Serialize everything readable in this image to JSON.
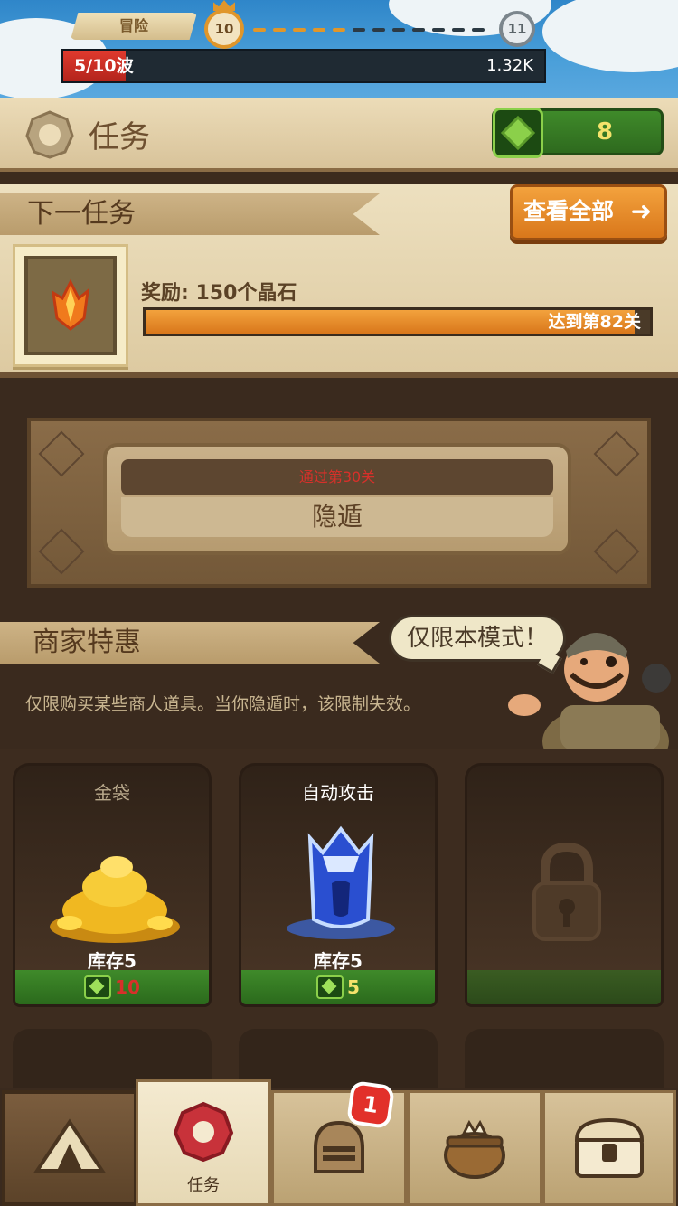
{
  "top_bar": {
    "mode_label": "冒险",
    "current_level": "10",
    "next_level": "11",
    "wave_text": "5/10波",
    "wave_progress": 0.13,
    "dps_text": "1.32K"
  },
  "header": {
    "title": "任务",
    "gem_count": "8"
  },
  "next_task": {
    "section_title": "下一任务",
    "view_all_label": "查看全部",
    "reward_label": "奖励: 150个晶石",
    "goal_text": "达到第82关",
    "progress": 0.97
  },
  "hide": {
    "requirement_text": "通过第30关",
    "button_label": "隐遁"
  },
  "merchant": {
    "section_title": "商家特惠",
    "speech_bubble": "仅限本模式！",
    "description": "仅限购买某些商人道具。当你隐遁时，该限制失效。"
  },
  "shop_items": [
    {
      "title": "金袋",
      "stock": "库存5",
      "price": "10",
      "price_color": "#d8302a",
      "title_color": "#b9a98c",
      "locked": false
    },
    {
      "title": "自动攻击",
      "stock": "库存5",
      "price": "5",
      "price_color": "#f5e36b",
      "title_color": "#ffffff",
      "locked": false
    },
    {
      "title": "",
      "stock": "",
      "price": "",
      "locked": true
    }
  ],
  "bottom_nav": {
    "items": [
      {
        "name": "camp",
        "label": ""
      },
      {
        "name": "tasks",
        "label": "任务"
      },
      {
        "name": "heroes",
        "label": ""
      },
      {
        "name": "cauldron",
        "label": ""
      },
      {
        "name": "chest",
        "label": ""
      }
    ],
    "heroes_badge": "1"
  },
  "colors": {
    "accent_orange": "#e38828",
    "gem_green": "#3f8a2a",
    "alert_red": "#e2302a",
    "parchment": "#ecdcb8"
  }
}
